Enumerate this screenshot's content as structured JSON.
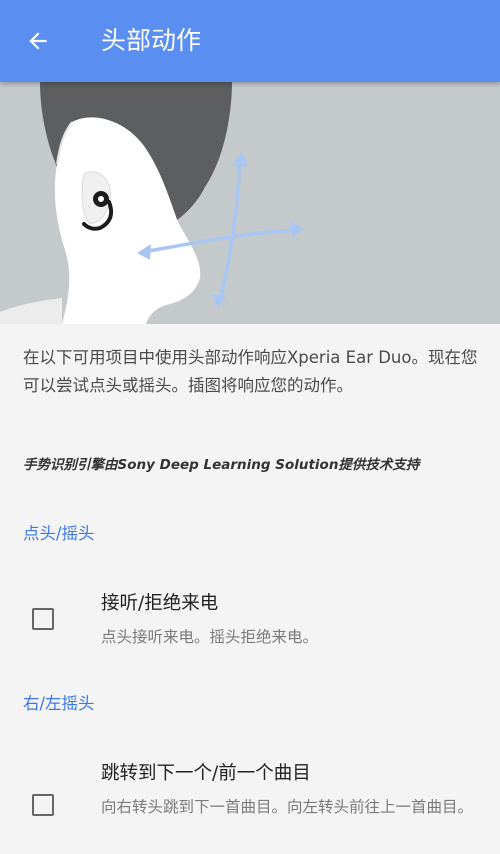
{
  "header": {
    "title": "头部动作",
    "back_icon": "arrow-back-icon",
    "background_color": "#5a8ef0"
  },
  "illustration": {
    "description_icon": "head-gesture-illustration",
    "arrow_color": "#a9c6f2"
  },
  "description": "在以下可用项目中使用头部动作响应Xperia Ear Duo。现在您可以尝试点头或摇头。插图将响应您的动作。",
  "powered_by": "手势识别引擎由Sony Deep Learning Solution提供技术支持",
  "sections": [
    {
      "header": "点头/摇头",
      "items": [
        {
          "title": "接听/拒绝来电",
          "summary": "点头接听来电。摇头拒绝来电。",
          "checked": false
        }
      ]
    },
    {
      "header": "右/左摇头",
      "items": [
        {
          "title": "跳转到下一个/前一个曲目",
          "summary": "向右转头跳到下一首曲目。向左转头前往上一首曲目。",
          "checked": false
        }
      ]
    }
  ],
  "accent_color": "#3d78e6"
}
